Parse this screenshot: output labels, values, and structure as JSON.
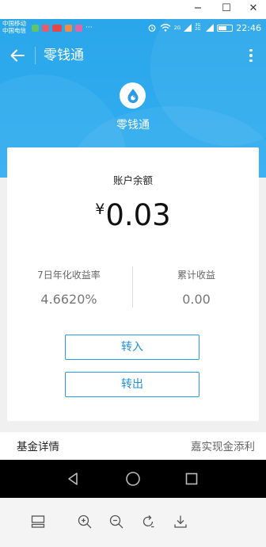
{
  "window": {
    "minimize_glyph": "−",
    "maximize_glyph": "☐",
    "close_glyph": "✕"
  },
  "status_bar": {
    "carrier_1": "中国移动",
    "carrier_2": "中国电信",
    "notification_icons": [
      {
        "name": "chat-notification-icon",
        "color": "#5fc56b"
      },
      {
        "name": "app-notification-icon",
        "color": "#e85b6a"
      },
      {
        "name": "shop-notification-icon",
        "color": "#e34848"
      },
      {
        "name": "app-notification-icon-2",
        "color": "#ef8c4a"
      },
      {
        "name": "app-notification-icon-3",
        "color": "#d96aa5"
      }
    ],
    "more_notifications": "···",
    "network_1": "2G",
    "network_2": "3G 2G",
    "time": "22:46"
  },
  "app_bar": {
    "title": "零钱通",
    "back_icon": "arrow-left-icon",
    "menu_icon": "more-vertical-icon"
  },
  "header": {
    "logo_icon": "wallet-drop-logo",
    "logo_name": "零钱通"
  },
  "account": {
    "balance_label": "账户余额",
    "currency_symbol": "¥",
    "balance": "0.03",
    "annual_yield_label": "7日年化收益率",
    "annual_yield": "4.6620%",
    "cumulative_label": "累计收益",
    "cumulative": "0.00",
    "transfer_in_label": "转入",
    "transfer_out_label": "转出"
  },
  "fund": {
    "label": "基金详情",
    "fund_name": "嘉实现金添利"
  },
  "nav": {
    "back": "nav-back-icon",
    "home": "nav-home-icon",
    "recents": "nav-recents-icon"
  },
  "toolbar": {
    "tools": [
      "layout-icon",
      "zoom-in-icon",
      "zoom-out-icon",
      "rotate-icon",
      "download-icon"
    ]
  },
  "colors": {
    "header_blue": "#2fabee",
    "accent": "#1f8fdc",
    "background": "#f0f0f0"
  }
}
